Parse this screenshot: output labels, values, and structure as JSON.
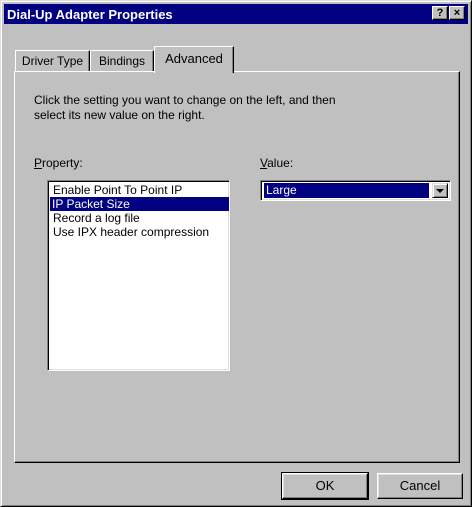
{
  "window": {
    "title": "Dial-Up Adapter Properties",
    "help_glyph": "?",
    "close_glyph": "×"
  },
  "tabs": [
    {
      "label": "Driver Type",
      "active": false
    },
    {
      "label": "Bindings",
      "active": false
    },
    {
      "label": "Advanced",
      "active": true
    }
  ],
  "advanced": {
    "instructions_line1": "Click the setting you want to change on the left, and then",
    "instructions_line2": "select its new value on the right.",
    "property_label_hotkey": "P",
    "property_label_rest": "roperty:",
    "value_label_hotkey": "V",
    "value_label_rest": "alue:",
    "properties": [
      "Enable Point To Point IP",
      "IP Packet Size",
      "Record a log file",
      "Use IPX header compression"
    ],
    "selected_property": "IP Packet Size",
    "value": "Large"
  },
  "buttons": {
    "ok": "OK",
    "cancel": "Cancel"
  },
  "colors": {
    "face": "#c0c0c0",
    "title_bg": "#000080",
    "selection": "#000080"
  }
}
